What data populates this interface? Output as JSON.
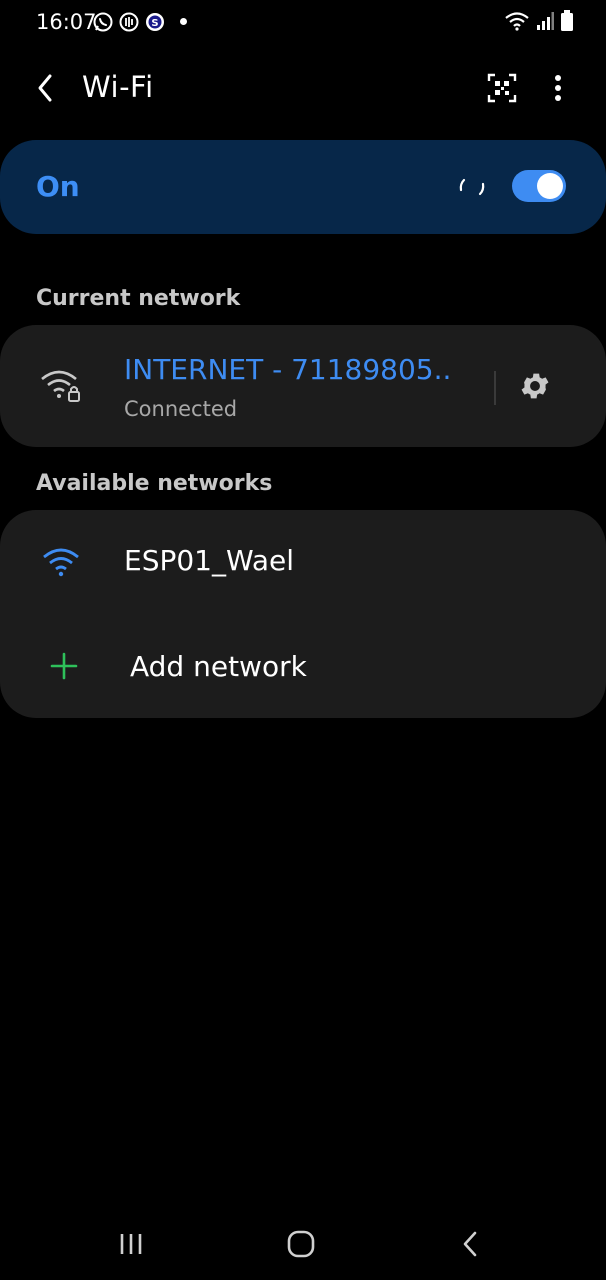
{
  "status_bar": {
    "time": "16:07",
    "left_icons": [
      "whatsapp-icon",
      "audio-icon",
      "shazam-icon"
    ],
    "right_icons": [
      "wifi-status-icon",
      "signal-icon",
      "battery-icon"
    ]
  },
  "header": {
    "title": "Wi-Fi",
    "back_icon": "chevron-left-icon",
    "qr_icon": "qr-scan-icon",
    "more_icon": "more-vertical-icon"
  },
  "wifi_toggle": {
    "label": "On",
    "state": true
  },
  "current_network": {
    "section_label": "Current network",
    "ssid": "INTERNET - 71189805..",
    "status": "Connected",
    "secured": true
  },
  "available_networks": {
    "section_label": "Available networks",
    "items": [
      {
        "ssid": "ESP01_Wael",
        "secured": false
      }
    ],
    "add_label": "Add network"
  },
  "colors": {
    "accent": "#3e8cf2",
    "toggle_bar_bg": "#072749",
    "card_bg": "#1c1c1c",
    "add_icon": "#2ec05a"
  }
}
